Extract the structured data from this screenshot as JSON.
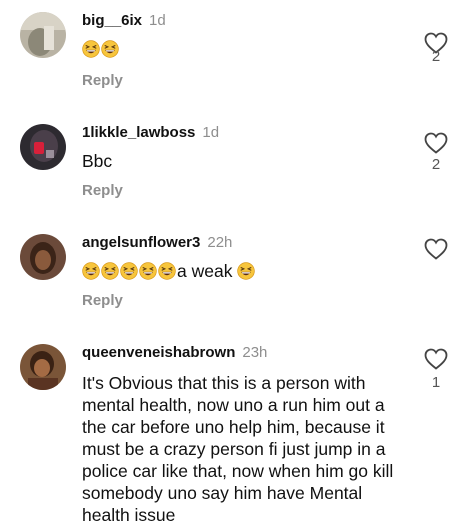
{
  "comments": [
    {
      "username": "big__6ix",
      "time": "1d",
      "emoji_count": 2,
      "text": "",
      "reply_label": "Reply",
      "likes": "2",
      "icons": [
        "grinning-squinting-face-emoji",
        "heart-outline-icon"
      ]
    },
    {
      "username": "1likkle_lawboss",
      "time": "1d",
      "text": "Bbc",
      "reply_label": "Reply",
      "likes": "2",
      "icons": [
        "heart-outline-icon"
      ]
    },
    {
      "username": "angelsunflower3",
      "time": "22h",
      "emoji_count": 5,
      "text": "a weak",
      "trailing_emoji": true,
      "reply_label": "Reply",
      "likes": "",
      "icons": [
        "grinning-squinting-face-emoji",
        "heart-outline-icon"
      ]
    },
    {
      "username": "queenveneishabrown",
      "time": "23h",
      "text": "It's Obvious that this is a person with mental health, now uno a run him out a the car before uno help him, because it must be a crazy person fi just jump in a police car like that, now when him go kill somebody uno say him have Mental health issue",
      "likes": "1",
      "icons": [
        "heart-outline-icon"
      ]
    }
  ],
  "colors": {
    "text": "#111111",
    "secondary": "#8e8e8e",
    "emoji_face": "#f7c53c"
  }
}
